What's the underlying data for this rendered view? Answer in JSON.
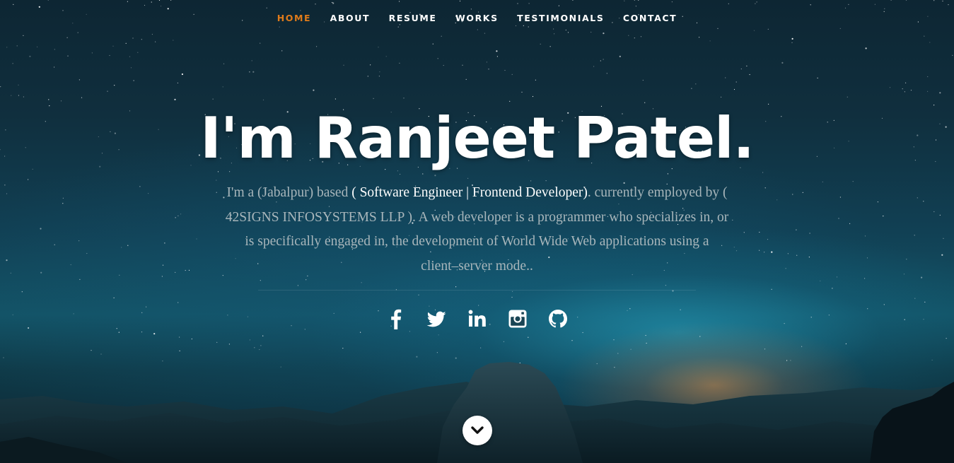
{
  "nav": {
    "items": [
      {
        "label": "HOME",
        "active": true
      },
      {
        "label": "ABOUT",
        "active": false
      },
      {
        "label": "RESUME",
        "active": false
      },
      {
        "label": "WORKS",
        "active": false
      },
      {
        "label": "TESTIMONIALS",
        "active": false
      },
      {
        "label": "CONTACT",
        "active": false
      }
    ],
    "active_color": "#e07b1a"
  },
  "hero": {
    "title": "I'm Ranjeet Patel.",
    "intro": {
      "part1": "I'm a (Jabalpur) based ",
      "role": "( Software Engineer | Frontend Developer)",
      "part2": ". currently employed by ( 42SIGNS INFOSYSTEMS LLP ). A web developer is a programmer who specializes in, or is specifically engaged in, the development of World Wide Web applications using a client–server mode.."
    }
  },
  "social": [
    {
      "name": "facebook",
      "icon": "facebook-icon"
    },
    {
      "name": "twitter",
      "icon": "twitter-icon"
    },
    {
      "name": "linkedin",
      "icon": "linkedin-icon"
    },
    {
      "name": "instagram",
      "icon": "instagram-icon"
    },
    {
      "name": "github",
      "icon": "github-icon"
    }
  ],
  "scroll_down": {
    "icon": "chevron-down-icon"
  }
}
